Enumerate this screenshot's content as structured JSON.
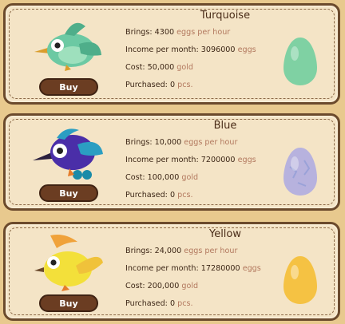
{
  "labels": {
    "brings": "Brings:",
    "income": "Income per month:",
    "cost": "Cost:",
    "purchased": "Purchased:"
  },
  "units": {
    "rate": "eggs per hour",
    "monthly": "eggs",
    "currency": "gold",
    "pieces": "pcs."
  },
  "birds": [
    {
      "name": "Turquoise",
      "brings": "4300",
      "income": "3096000",
      "cost": "50,000",
      "purchased": "0",
      "buy_label": "Buy",
      "bird_color": "#6cc9a3",
      "egg_color": "#7fd1a3"
    },
    {
      "name": "Blue",
      "brings": "10,000",
      "income": "7200000",
      "cost": "100,000",
      "purchased": "0",
      "buy_label": "Buy",
      "bird_color": "#4a2ea8",
      "egg_color": "#b7b2de"
    },
    {
      "name": "Yellow",
      "brings": "24,000",
      "income": "17280000",
      "cost": "200,000",
      "purchased": "0",
      "buy_label": "Buy",
      "bird_color": "#f3e03a",
      "egg_color": "#f5c243"
    }
  ]
}
